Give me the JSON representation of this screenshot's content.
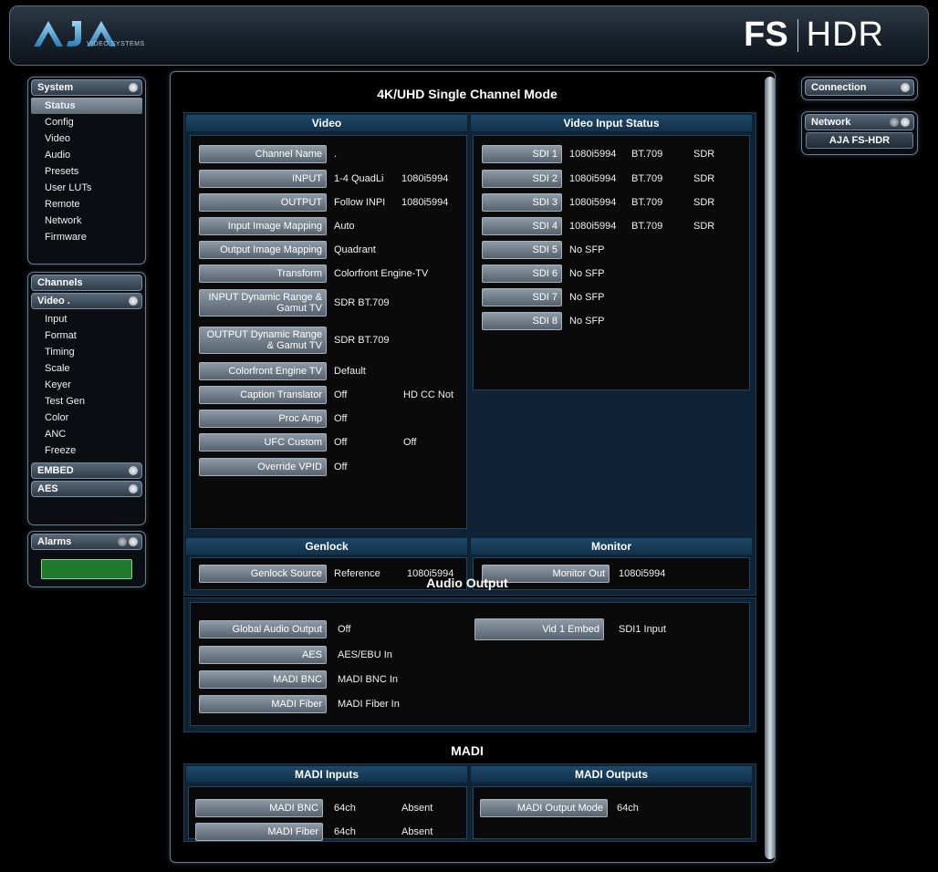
{
  "header": {
    "logo_text": "AJA",
    "logo_subtitle": "VIDEO SYSTEMS",
    "brand_fs": "FS",
    "brand_hdr": "HDR"
  },
  "sidebar": {
    "system": {
      "title": "System",
      "items": [
        "Status",
        "Config",
        "Video",
        "Audio",
        "Presets",
        "User LUTs",
        "Remote",
        "Network",
        "Firmware"
      ]
    },
    "channels": {
      "title": "Channels"
    },
    "video": {
      "title": "Video .",
      "items": [
        "Input",
        "Format",
        "Timing",
        "Scale",
        "Keyer",
        "Test Gen",
        "Color",
        "ANC",
        "Freeze"
      ]
    },
    "embed": {
      "title": "EMBED"
    },
    "aes": {
      "title": "AES"
    },
    "alarms": {
      "title": "Alarms"
    }
  },
  "right": {
    "connection": "Connection",
    "network": "Network",
    "device": "AJA FS-HDR"
  },
  "main": {
    "mode_title": "4K/UHD Single Channel Mode",
    "video": {
      "title": "Video",
      "rows": [
        {
          "label": "Channel Name",
          "v1": ".",
          "v2": ""
        },
        {
          "label": "INPUT",
          "v1": "1-4 QuadLi",
          "v2": "1080i5994"
        },
        {
          "label": "OUTPUT",
          "v1": "Follow INPI",
          "v2": "1080i5994"
        },
        {
          "label": "Input Image Mapping",
          "v1": "Auto",
          "v2": ""
        },
        {
          "label": "Output Image Mapping",
          "v1": "Quadrant",
          "v2": ""
        },
        {
          "label": "Transform",
          "v1": "Colorfront Engine-TV",
          "v2": ""
        },
        {
          "label": "INPUT Dynamic Range & Gamut TV",
          "v1": "SDR BT.709",
          "v2": ""
        },
        {
          "label": "OUTPUT Dynamic Range & Gamut TV",
          "v1": "SDR BT.709",
          "v2": ""
        },
        {
          "label": "Colorfront Engine TV",
          "v1": "Default",
          "v2": ""
        },
        {
          "label": "Caption Translator",
          "v1": "Off",
          "v2": "HD CC Not"
        },
        {
          "label": "Proc Amp",
          "v1": "Off",
          "v2": ""
        },
        {
          "label": "UFC Custom",
          "v1": "Off",
          "v2": "Off"
        },
        {
          "label": "Override VPID",
          "v1": "Off",
          "v2": ""
        }
      ]
    },
    "video_input_status": {
      "title": "Video Input Status",
      "rows": [
        {
          "label": "SDI 1",
          "fmt": "1080i5994",
          "cs": "BT.709",
          "dr": "SDR"
        },
        {
          "label": "SDI 2",
          "fmt": "1080i5994",
          "cs": "BT.709",
          "dr": "SDR"
        },
        {
          "label": "SDI 3",
          "fmt": "1080i5994",
          "cs": "BT.709",
          "dr": "SDR"
        },
        {
          "label": "SDI 4",
          "fmt": "1080i5994",
          "cs": "BT.709",
          "dr": "SDR"
        },
        {
          "label": "SDI 5",
          "fmt": "No SFP",
          "cs": "",
          "dr": ""
        },
        {
          "label": "SDI 6",
          "fmt": "No SFP",
          "cs": "",
          "dr": ""
        },
        {
          "label": "SDI 7",
          "fmt": "No SFP",
          "cs": "",
          "dr": ""
        },
        {
          "label": "SDI 8",
          "fmt": "No SFP",
          "cs": "",
          "dr": ""
        }
      ]
    },
    "genlock": {
      "title": "Genlock",
      "label": "Genlock Source",
      "v1": "Reference",
      "v2": "1080i5994"
    },
    "monitor": {
      "title": "Monitor",
      "label": "Monitor Out",
      "v1": "1080i5994"
    },
    "audio_output": {
      "title": "Audio Output",
      "rows": [
        {
          "label": "Global Audio Output",
          "v1": "Off"
        },
        {
          "label": "AES",
          "v1": "AES/EBU In"
        },
        {
          "label": "MADI BNC",
          "v1": "MADI BNC In"
        },
        {
          "label": "MADI Fiber",
          "v1": "MADI Fiber In"
        }
      ],
      "embed_label": "Vid 1 Embed",
      "embed_value": "SDI1 Input"
    },
    "madi": {
      "title": "MADI",
      "inputs_title": "MADI Inputs",
      "outputs_title": "MADI Outputs",
      "inputs": [
        {
          "label": "MADI BNC",
          "v1": "64ch",
          "v2": "Absent"
        },
        {
          "label": "MADI Fiber",
          "v1": "64ch",
          "v2": "Absent"
        }
      ],
      "output_label": "MADI Output Mode",
      "output_value": "64ch"
    }
  }
}
